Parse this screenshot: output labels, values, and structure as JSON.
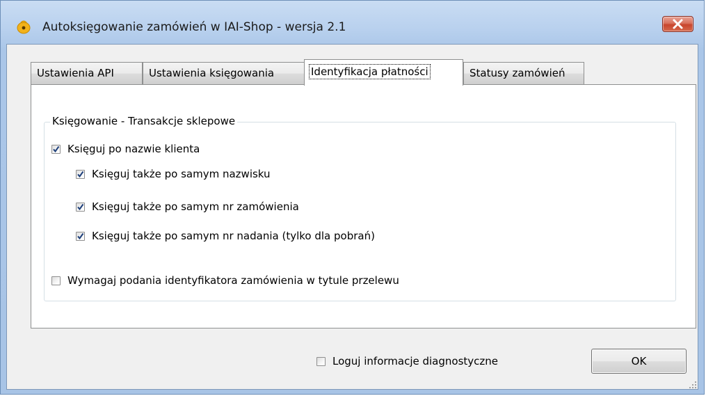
{
  "window": {
    "title": "Autoksięgowanie zamówień w IAI-Shop - wersja 2.1",
    "icon": "app-moneybag-icon",
    "close_icon": "close-icon"
  },
  "tabs": [
    {
      "label": "Ustawienia API",
      "active": false
    },
    {
      "label": "Ustawienia księgowania",
      "active": false
    },
    {
      "label": "Identyfikacja płatności",
      "active": true
    },
    {
      "label": "Statusy zamówień",
      "active": false
    }
  ],
  "group": {
    "legend": "Księgowanie - Transakcje sklepowe",
    "items": [
      {
        "label": "Księguj po nazwie klienta",
        "checked": true
      },
      {
        "label": "Księguj także po samym nazwisku",
        "checked": true
      },
      {
        "label": "Księguj także po samym nr zamówienia",
        "checked": true
      },
      {
        "label": "Księguj także po samym nr nadania (tylko dla pobrań)",
        "checked": true
      },
      {
        "label": "Wymagaj podania identyfikatora zamówienia w tytule przelewu",
        "checked": false
      }
    ]
  },
  "footer": {
    "diagnostics": {
      "label": "Loguj informacje diagnostyczne",
      "checked": false
    },
    "ok_label": "OK"
  },
  "colors": {
    "frame": "#a8c4e6",
    "close_button": "#c8452c",
    "checkmark": "#1d3f7a"
  }
}
